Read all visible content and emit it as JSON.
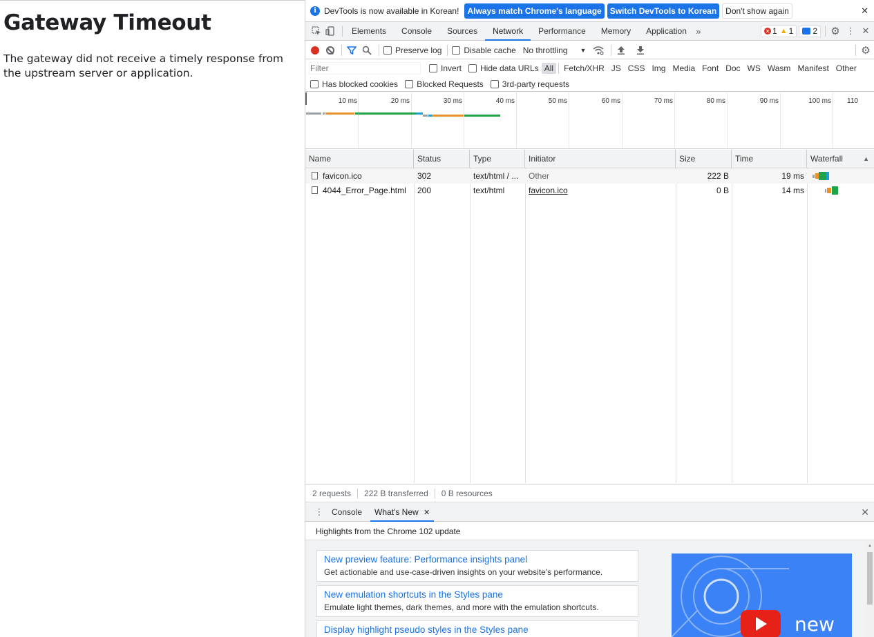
{
  "page": {
    "title": "Gateway Timeout",
    "message": "The gateway did not receive a timely response from the upstream server or application."
  },
  "infobar": {
    "message": "DevTools is now available in Korean!",
    "btn_match": "Always match Chrome's language",
    "btn_switch": "Switch DevTools to Korean",
    "btn_dismiss": "Don't show again"
  },
  "tabs": [
    "Elements",
    "Console",
    "Sources",
    "Network",
    "Performance",
    "Memory",
    "Application"
  ],
  "badges": {
    "errors": "1",
    "warnings": "1",
    "messages": "2"
  },
  "toolbar": {
    "preserve_log": "Preserve log",
    "disable_cache": "Disable cache",
    "throttling": "No throttling"
  },
  "filter": {
    "placeholder": "Filter",
    "invert": "Invert",
    "hide_data_urls": "Hide data URLs",
    "types": [
      "All",
      "Fetch/XHR",
      "JS",
      "CSS",
      "Img",
      "Media",
      "Font",
      "Doc",
      "WS",
      "Wasm",
      "Manifest",
      "Other"
    ],
    "has_blocked_cookies": "Has blocked cookies",
    "blocked_requests": "Blocked Requests",
    "third_party": "3rd-party requests"
  },
  "overview": {
    "labels": [
      "10 ms",
      "20 ms",
      "30 ms",
      "40 ms",
      "50 ms",
      "60 ms",
      "70 ms",
      "80 ms",
      "90 ms",
      "100 ms",
      "110"
    ]
  },
  "table": {
    "headers": {
      "name": "Name",
      "status": "Status",
      "type": "Type",
      "initiator": "Initiator",
      "size": "Size",
      "time": "Time",
      "waterfall": "Waterfall"
    },
    "rows": [
      {
        "name": "favicon.ico",
        "status": "302",
        "type": "text/html / ...",
        "initiator": "Other",
        "size": "222 B",
        "time": "19 ms"
      },
      {
        "name": "4044_Error_Page.html",
        "status": "200",
        "type": "text/html",
        "initiator": "favicon.ico",
        "size": "0 B",
        "time": "14 ms"
      }
    ]
  },
  "status": {
    "requests": "2 requests",
    "transferred": "222 B transferred",
    "resources": "0 B resources"
  },
  "drawer": {
    "tabs": [
      "Console",
      "What's New"
    ],
    "highlights": "Highlights from the Chrome 102 update",
    "cards": [
      {
        "title": "New preview feature: Performance insights panel",
        "desc": "Get actionable and use-case-driven insights on your website's performance."
      },
      {
        "title": "New emulation shortcuts in the Styles pane",
        "desc": "Emulate light themes, dark themes, and more with the emulation shortcuts."
      },
      {
        "title": "Display highlight pseudo styles in the Styles pane",
        "desc": ""
      }
    ],
    "image_text": "new"
  }
}
